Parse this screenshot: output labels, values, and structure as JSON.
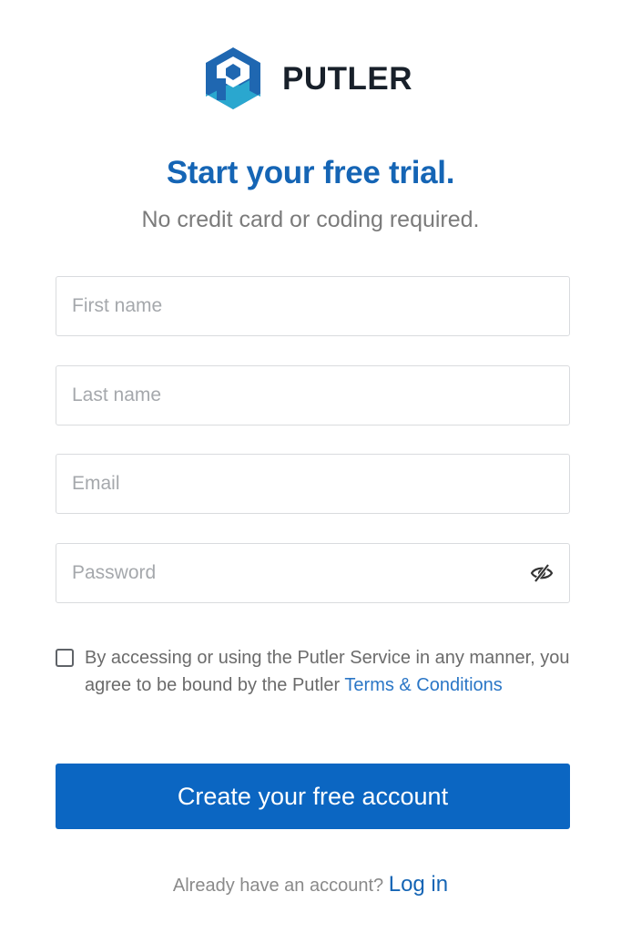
{
  "brand": {
    "name": "PUTLER",
    "logo_icon": "putler-cube-logo",
    "colors": {
      "logo_dark_blue": "#1f67b1",
      "logo_teal": "#2aa7cf",
      "accent": "#0b66c2",
      "heading_blue": "#1565b5"
    }
  },
  "hero": {
    "title": "Start your free trial.",
    "subtitle": "No credit card or coding required."
  },
  "form": {
    "first_name_placeholder": "First name",
    "last_name_placeholder": "Last name",
    "email_placeholder": "Email",
    "password_placeholder": "Password",
    "password_toggle_icon": "eye-slash-icon",
    "consent": {
      "checked": false,
      "text": "By accessing or using the Putler Service in any manner, you agree to be bound by the Putler ",
      "link": "Terms & Conditions"
    },
    "submit_label": "Create your free account"
  },
  "footer": {
    "prompt": "Already have an account? ",
    "login_link": "Log in"
  }
}
